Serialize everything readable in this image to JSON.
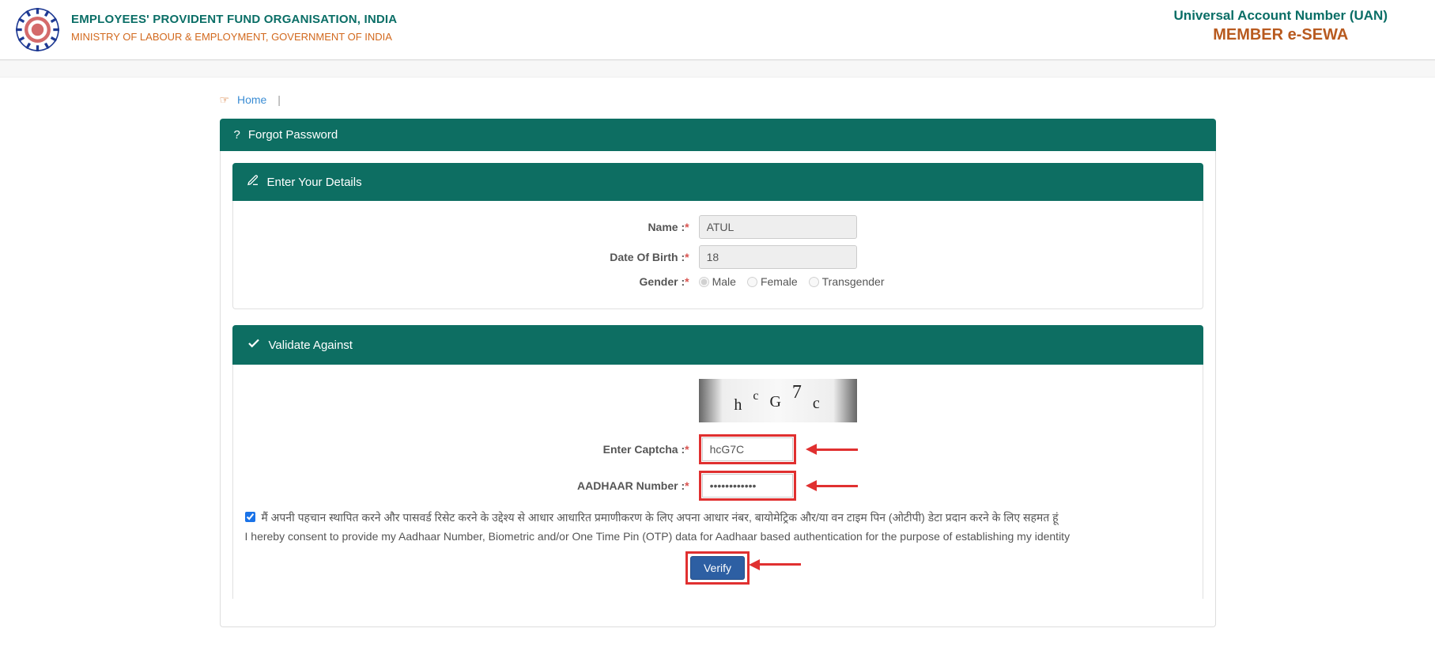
{
  "header": {
    "org_title": "EMPLOYEES' PROVIDENT FUND ORGANISATION, INDIA",
    "org_subtitle": "MINISTRY OF LABOUR & EMPLOYMENT, GOVERNMENT OF INDIA",
    "uan_title": "Universal Account Number (UAN)",
    "member_sewa": "MEMBER e-SEWA"
  },
  "breadcrumb": {
    "home": "Home"
  },
  "panel": {
    "forgot_password": "Forgot Password",
    "enter_details": "Enter Your Details",
    "validate_against": "Validate Against"
  },
  "form": {
    "name_label": "Name :",
    "name_value": "ATUL",
    "dob_label": "Date Of Birth :",
    "dob_value": "18",
    "gender_label": "Gender :",
    "gender_male": "Male",
    "gender_female": "Female",
    "gender_trans": "Transgender",
    "captcha_label": "Enter Captcha :",
    "captcha_value": "hcG7C",
    "captcha_chars": [
      "h",
      "c",
      "G",
      "7",
      "c"
    ],
    "aadhaar_label": "AADHAAR Number :",
    "aadhaar_value": "••••••••••••",
    "consent_hi": "मैं अपनी पहचान स्थापित करने और पासवर्ड रिसेट करने के उद्देश्य से आधार आधारित प्रमाणीकरण के लिए अपना आधार नंबर, बायोमेट्रिक और/या वन टाइम पिन (ओटीपी) डेटा प्रदान करने के लिए सहमत हूं",
    "consent_en": "I hereby consent to provide my Aadhaar Number, Biometric and/or One Time Pin (OTP) data for Aadhaar based authentication for the purpose of establishing my identity",
    "verify_button": "Verify"
  }
}
